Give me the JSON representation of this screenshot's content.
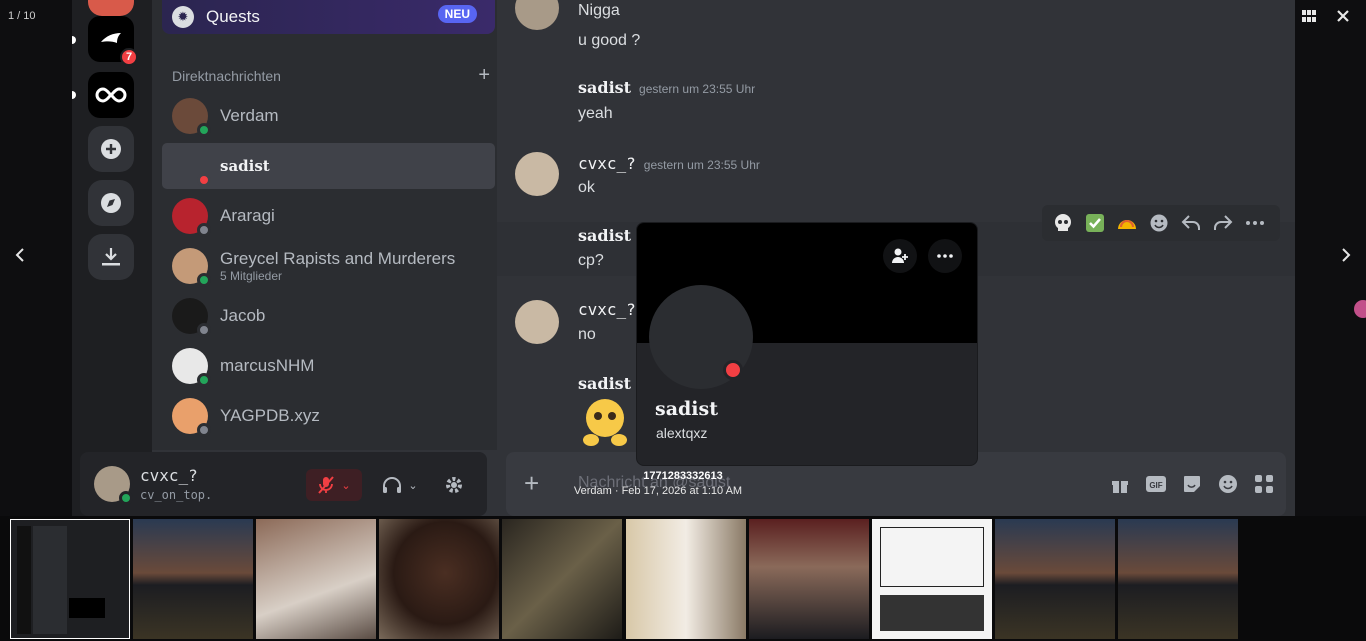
{
  "viewer": {
    "counter": "1 / 10",
    "toolbar": [
      "zoom-icon",
      "open-external-icon",
      "fullscreen-icon",
      "play-icon",
      "download-icon",
      "grid-icon",
      "close-icon"
    ],
    "caption_title": "1771283332613",
    "caption_sub": "Verdam · Feb 17, 2026 at 1:10 AM"
  },
  "rail": {
    "badge": "7"
  },
  "dm": {
    "quests_label": "Quests",
    "neu_badge": "NEU",
    "header": "Direktnachrichten",
    "items": [
      {
        "name": "Verdam",
        "sub": "",
        "status": "online"
      },
      {
        "name": "sadist",
        "sub": "",
        "status": "dnd"
      },
      {
        "name": "Araragi",
        "sub": "",
        "status": "offline"
      },
      {
        "name": "Greycel Rapists and Murderers",
        "sub": "5 Mitglieder",
        "status": "online"
      },
      {
        "name": "Jacob",
        "sub": "",
        "status": "offline"
      },
      {
        "name": "marcusNHM",
        "sub": "",
        "status": "online"
      },
      {
        "name": "YAGPDB.xyz",
        "sub": "",
        "status": "offline"
      }
    ]
  },
  "user_panel": {
    "name": "cvxc_?",
    "status": "cv_on_top."
  },
  "chat": {
    "messages": [
      {
        "text1": "Nigga",
        "text2": "u good ?"
      },
      {
        "author": "sadist",
        "time": "gestern um 23:55 Uhr",
        "text": "yeah"
      },
      {
        "author": "cvxc_?",
        "time": "gestern um 23:55 Uhr",
        "text": "ok"
      },
      {
        "author": "sadist",
        "text": "cp?"
      },
      {
        "author": "cvxc_?",
        "text": "no"
      },
      {
        "author": "sadist"
      }
    ],
    "composer_placeholder": "Nachricht an @sadist"
  },
  "popout": {
    "display_name": "sadist",
    "username": "alextqxz"
  },
  "colors": {
    "accent": "#5865f2",
    "dnd": "#f23f43",
    "online": "#23a55a"
  }
}
